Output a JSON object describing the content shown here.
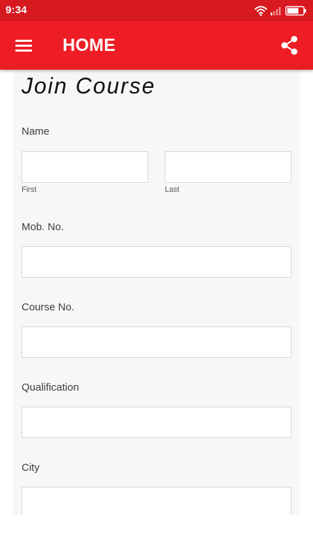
{
  "status_bar": {
    "time": "9:34"
  },
  "app_bar": {
    "title": "HOME",
    "menu_icon": "hamburger-menu-icon",
    "share_icon": "share-icon",
    "color": "#ee1d25"
  },
  "form": {
    "title": "Join Course",
    "name_label": "Name",
    "first_sublabel": "First",
    "last_sublabel": "Last",
    "first_value": "",
    "last_value": "",
    "mobile_label": "Mob. No.",
    "mobile_value": "",
    "course_label": "Course No.",
    "course_value": "",
    "qualification_label": "Qualification",
    "qualification_value": "",
    "city_label": "City",
    "city_value": ""
  }
}
